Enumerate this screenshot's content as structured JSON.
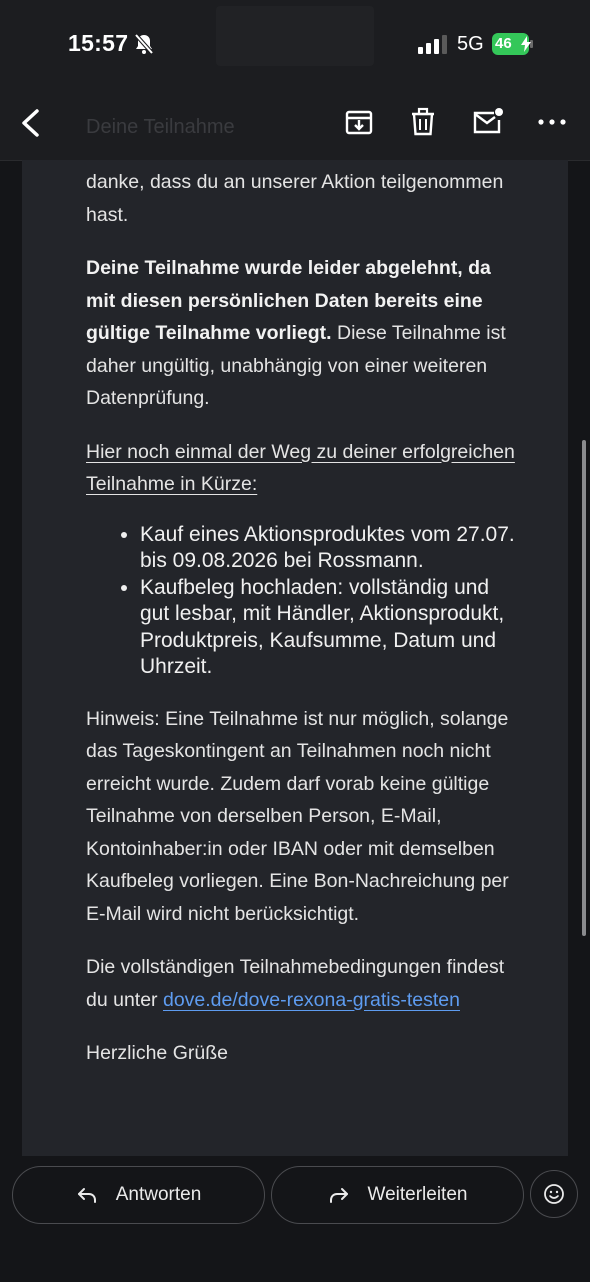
{
  "status_bar": {
    "time": "15:57",
    "network": "5G",
    "battery": "46"
  },
  "toolbar": {
    "back_icon": "chevron-left-icon",
    "subject": "Deine Teilnahme",
    "icons": [
      "archive-icon",
      "trash-icon",
      "mark-unread-icon",
      "more-icon"
    ]
  },
  "email": {
    "intro": "danke, dass du an unserer Aktion teilgenommen hast.",
    "rejection_bold": "Deine Teilnahme wurde leider abgelehnt, da mit diesen persönlichen Daten bereits eine gültige Teilnahme vorliegt.",
    "rejection_rest": " Diese Teilnahme ist daher ungültig, unabhängig von einer weiteren Datenprüfung.",
    "steps_heading": "Hier noch einmal der Weg zu deiner erfolgreichen Teilnahme in Kürze:",
    "steps": [
      "Kauf eines Aktionsproduktes vom 27.07. bis 09.08.2026 bei Rossmann.",
      "Kaufbeleg hochladen: vollständig und gut lesbar, mit Händler, Aktionsprodukt, Produktpreis, Kaufsumme, Datum und Uhrzeit."
    ],
    "notice": "Hinweis: Eine Teilnahme ist nur möglich, solange das Tageskontingent an Teilnahmen noch nicht erreicht wurde. Zudem darf vorab keine gültige Teilnahme von derselben Person, E-Mail, Kontoinhaber:in oder IBAN oder mit demselben Kaufbeleg vorliegen. Eine Bon-Nachreichung per E-Mail wird nicht berücksichtigt.",
    "terms_text": "Die vollständigen Teilnahmebedingungen findest du unter ",
    "terms_link": "dove.de/dove-rexona-gratis-testen",
    "closing": "Herzliche Grüße"
  },
  "actions": {
    "reply_label": "Antworten",
    "forward_label": "Weiterleiten",
    "reply_icon": "reply-icon",
    "forward_icon": "forward-icon",
    "emoji_icon": "emoji-icon"
  },
  "colors": {
    "background": "#141518",
    "card": "#23252a",
    "link": "#5e9cf0",
    "battery": "#34c759"
  }
}
